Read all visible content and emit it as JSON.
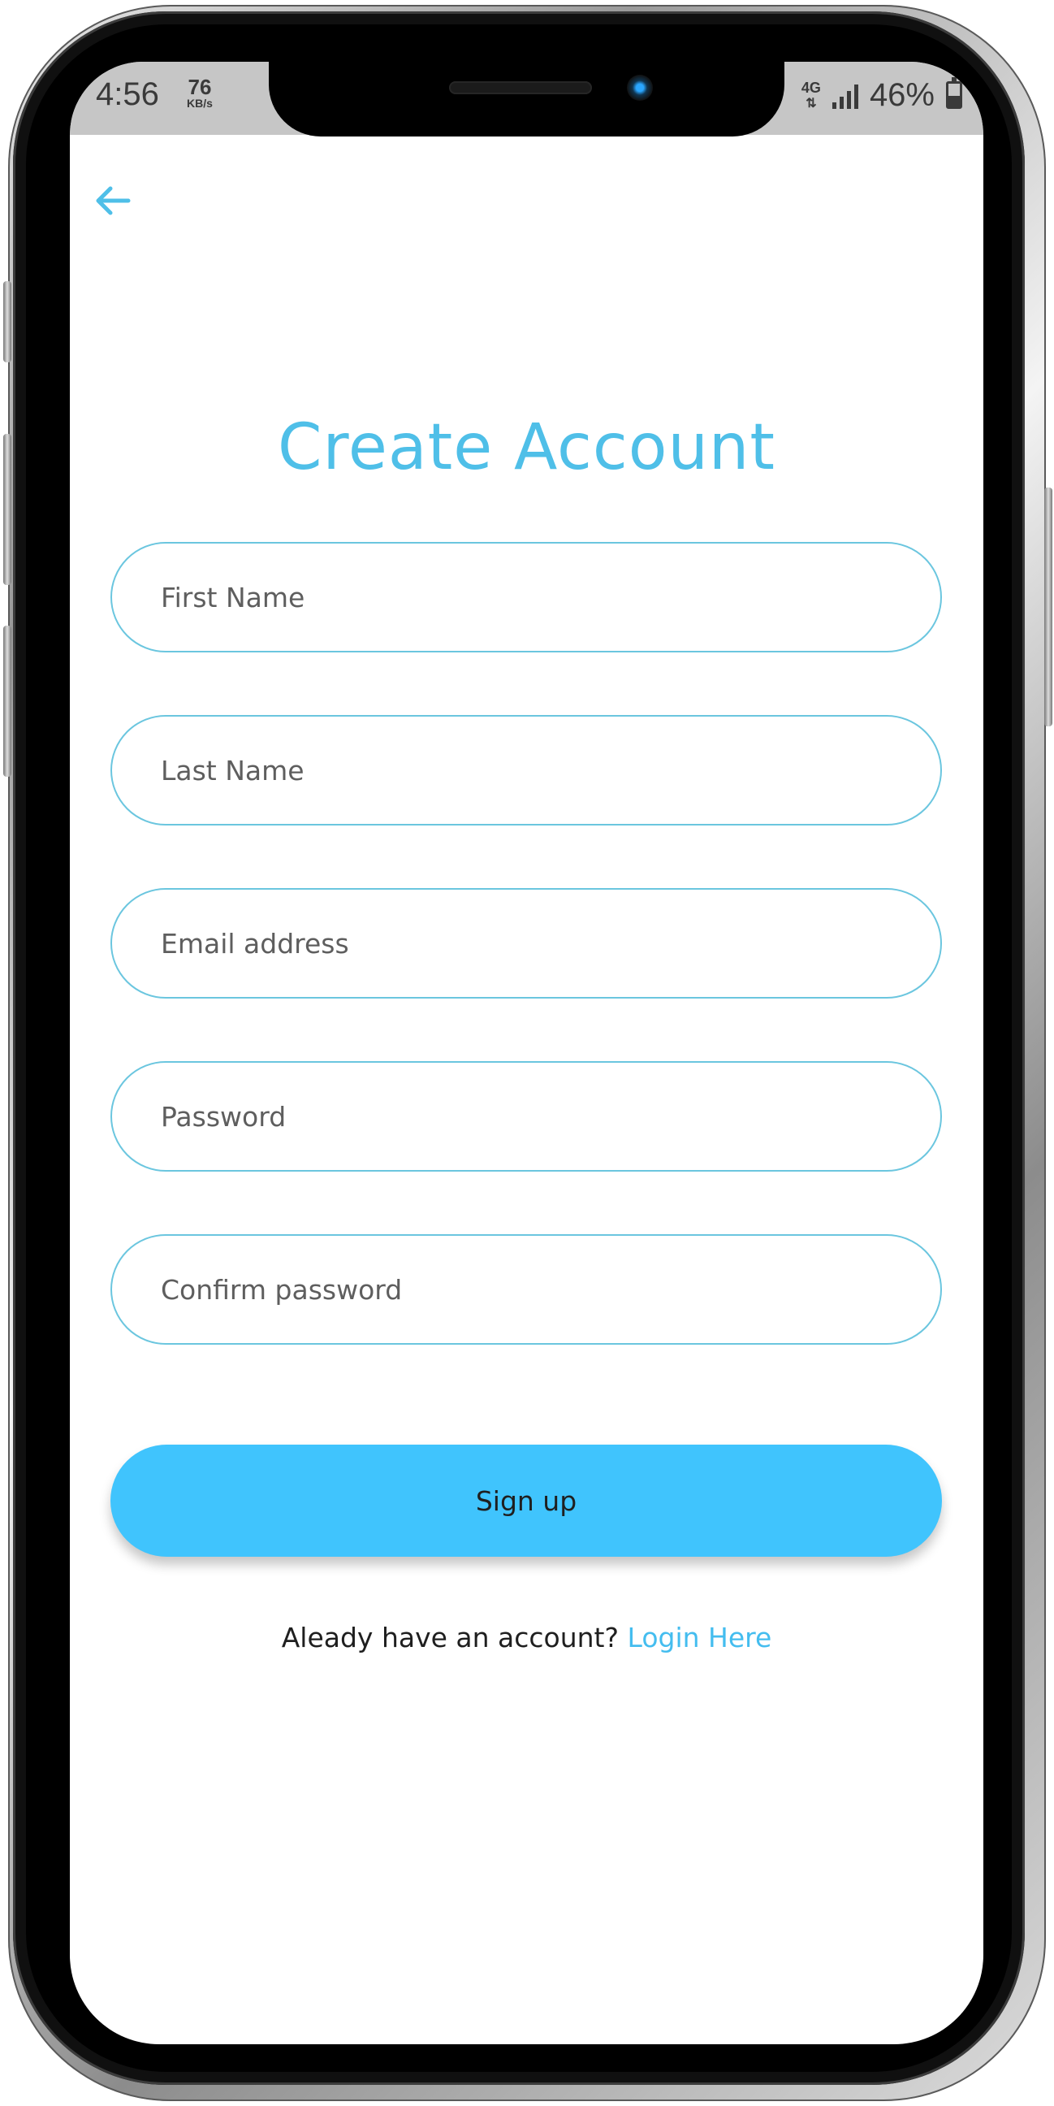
{
  "status_bar": {
    "time": "4:56",
    "net_speed_value": "76",
    "net_speed_unit": "KB/s",
    "network_type": "4G",
    "battery_percent": "46%"
  },
  "header": {
    "back_icon": "arrow-left-icon"
  },
  "form": {
    "title": "Create Account",
    "fields": [
      {
        "placeholder": "First Name",
        "value": ""
      },
      {
        "placeholder": "Last Name",
        "value": ""
      },
      {
        "placeholder": "Email address",
        "value": ""
      },
      {
        "placeholder": "Password",
        "value": ""
      },
      {
        "placeholder": "Confirm password",
        "value": ""
      }
    ],
    "submit_label": "Sign up"
  },
  "footer": {
    "prompt": "Aleady have an account?",
    "login_link": "Login Here"
  },
  "colors": {
    "accent": "#4fbfe8",
    "button": "#40c4fd",
    "field_border": "#6bc6df",
    "status_bar": "#c6c6c6"
  }
}
